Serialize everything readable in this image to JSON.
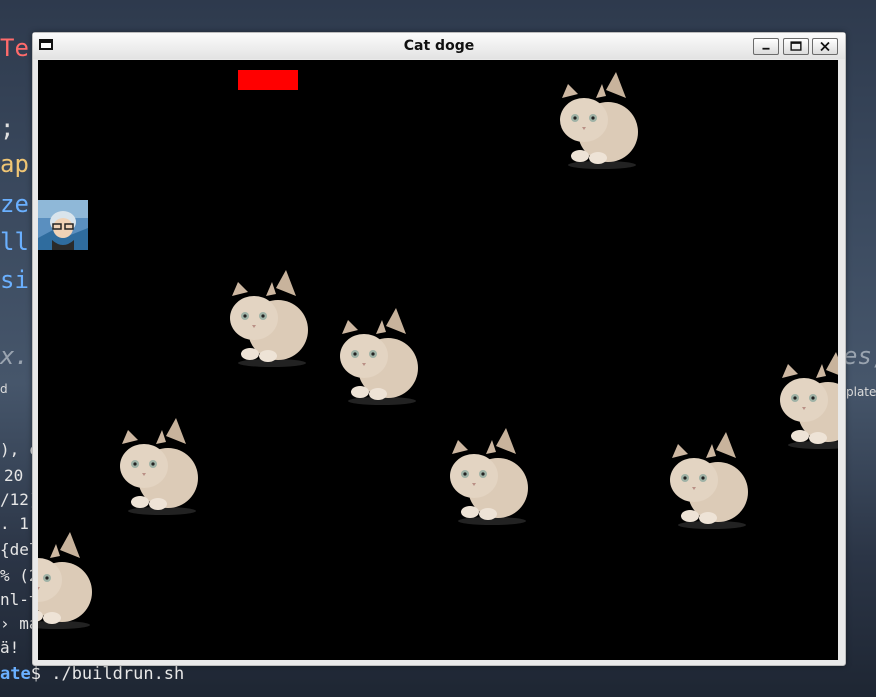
{
  "window": {
    "title": "Cat doge",
    "controls": [
      "minimize",
      "maximize",
      "close"
    ]
  },
  "background": {
    "code_fragments": [
      "Te",
      ";",
      "ap",
      "ze",
      "ll",
      "si",
      "x.",
      "es,"
    ],
    "sidebar_fragments": [
      "d",
      "plate",
      "), c",
      "20",
      "/12)",
      ". 1.",
      "{del",
      "% (2",
      "nl-t",
      "› ma",
      "ä!"
    ],
    "prompt": {
      "host": "ate",
      "symbol": "$",
      "command": "./buildrun.sh"
    }
  },
  "game": {
    "paddle_color": "#ff0000",
    "background_color": "#000000",
    "player_icon": "avatar-sprite",
    "enemy_icon": "kitten-sprite",
    "cats": [
      {
        "id": "cat-1"
      },
      {
        "id": "cat-2"
      },
      {
        "id": "cat-3"
      },
      {
        "id": "cat-4"
      },
      {
        "id": "cat-5"
      },
      {
        "id": "cat-6"
      },
      {
        "id": "cat-7"
      },
      {
        "id": "cat-8"
      },
      {
        "id": "cat-9"
      }
    ]
  }
}
